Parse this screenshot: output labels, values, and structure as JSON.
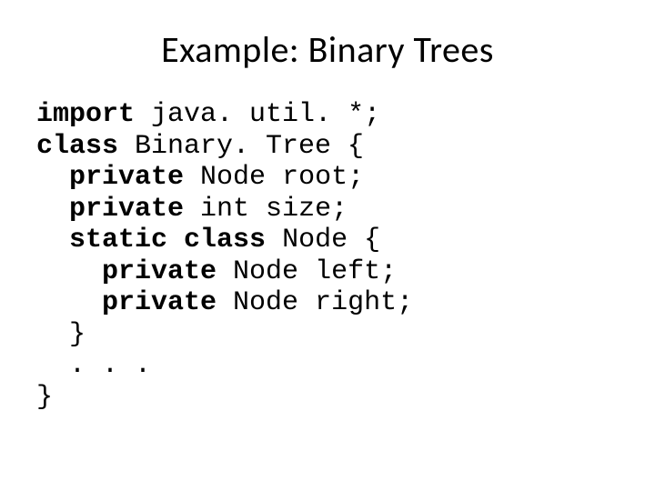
{
  "title": "Example: Binary Trees",
  "code": {
    "kw_import": "import",
    "import_rest": " java. util. *;",
    "kw_class1": "class",
    "class1_rest": " Binary. Tree {",
    "kw_private1": "private",
    "private1_rest": " Node root;",
    "kw_private2": "private",
    "private2_rest": " int size;",
    "kw_static_class": "static class",
    "static_class_rest": " Node {",
    "kw_private3": "private",
    "private3_rest": " Node left;",
    "kw_private4": "private",
    "private4_rest": " Node right;",
    "close1": "  }",
    "ellipsis": "  . . .",
    "close2": "}"
  }
}
